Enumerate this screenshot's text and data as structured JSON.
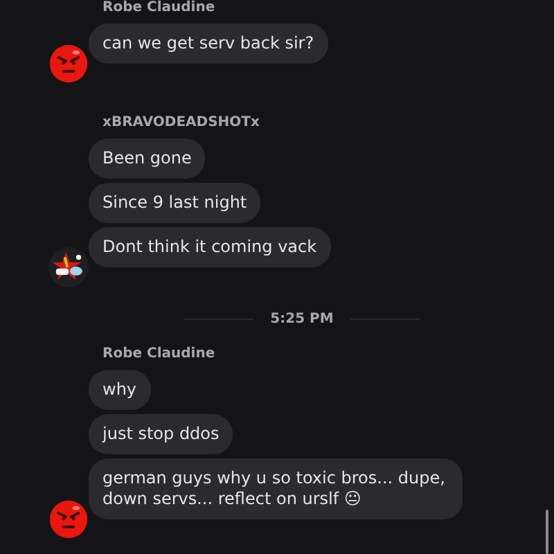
{
  "feed": [
    {
      "kind": "group",
      "sender": "Robe Claudine",
      "avatar": {
        "kind": "angry-face"
      },
      "messages": [
        "can we get serv back sir?"
      ]
    },
    {
      "kind": "group",
      "sender": "xBRAVODEADSHOTx",
      "avatar": {
        "kind": "star-character"
      },
      "messages": [
        "Been gone",
        "Since 9 last night",
        "Dont think it coming vack"
      ]
    },
    {
      "kind": "timestamp",
      "text": "5:25 PM"
    },
    {
      "kind": "group",
      "sender": "Robe Claudine",
      "avatar": {
        "kind": "angry-face"
      },
      "messages": [
        "why",
        "just stop ddos",
        "german guys why u so toxic bros... dupe, down servs... reflect on urslf 😐"
      ]
    }
  ]
}
